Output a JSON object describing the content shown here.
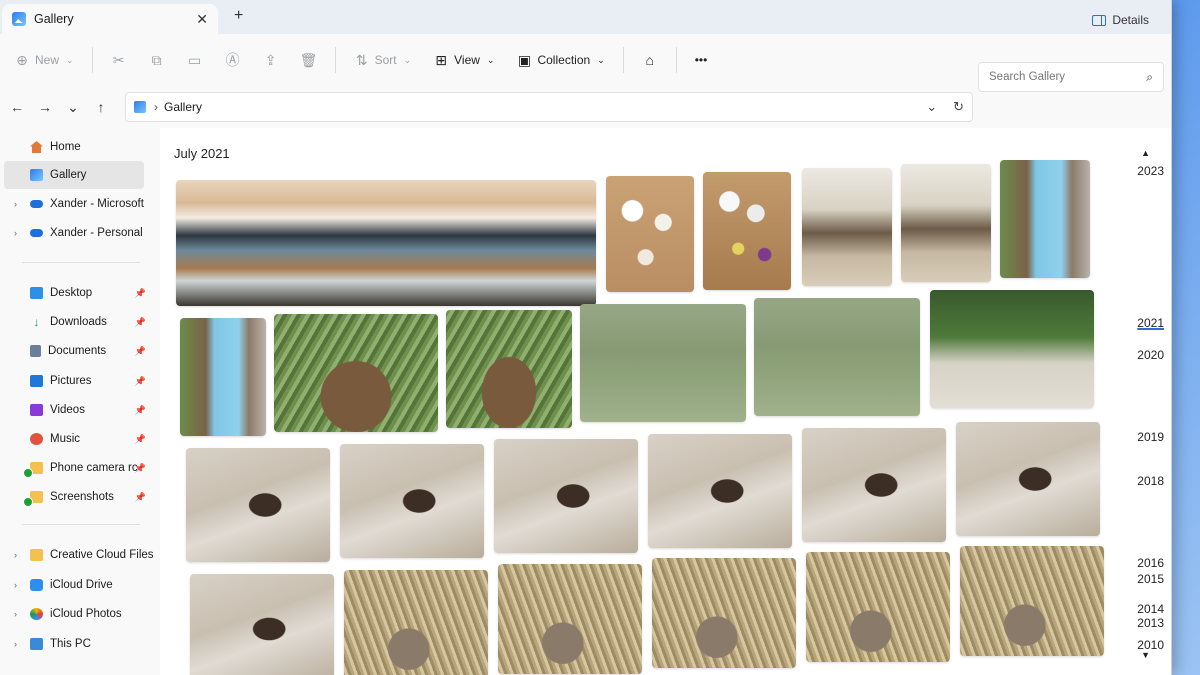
{
  "window": {
    "tab_title": "Gallery",
    "new_tab": "+",
    "close": "✕",
    "details_label": "Details"
  },
  "toolbar": {
    "new_label": "New",
    "sort_label": "Sort",
    "view_label": "View",
    "collection_label": "Collection",
    "more": "•••"
  },
  "addressbar": {
    "path": "Gallery",
    "search_placeholder": "Search Gallery"
  },
  "sidebar": {
    "home": "Home",
    "gallery": "Gallery",
    "cloud1": "Xander - Microsoft",
    "cloud2": "Xander - Personal",
    "desktop": "Desktop",
    "downloads": "Downloads",
    "documents": "Documents",
    "pictures": "Pictures",
    "videos": "Videos",
    "music": "Music",
    "phone": "Phone camera rc",
    "screenshots": "Screenshots",
    "creative": "Creative Cloud Files",
    "icloud_drive": "iCloud Drive",
    "icloud_photos": "iCloud Photos",
    "thispc": "This PC"
  },
  "main": {
    "month": "July 2021"
  },
  "timeline": {
    "y2023": "2023",
    "y2021": "2021",
    "y2020": "2020",
    "y2019": "2019",
    "y2018": "2018",
    "y2016": "2016",
    "y2015": "2015",
    "y2014": "2014",
    "y2013": "2013",
    "y2010": "2010"
  },
  "colors": {
    "accent": "#2b6fd6",
    "selected_bg": "#e5e5e5",
    "sync_ok": "#1da033"
  }
}
